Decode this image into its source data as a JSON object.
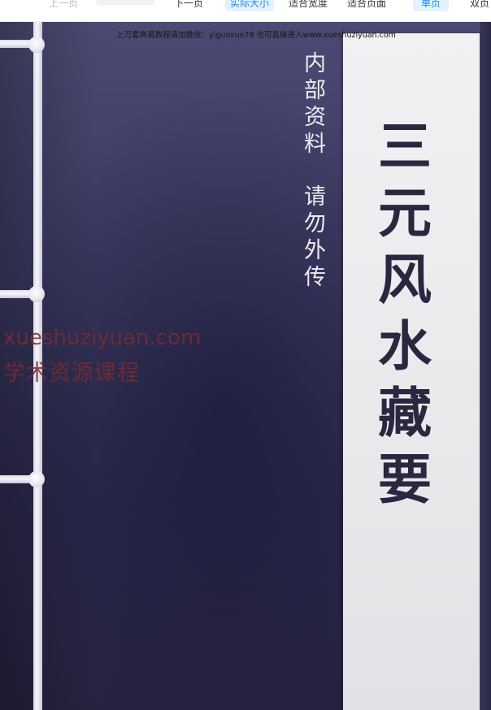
{
  "toolbar": {
    "prev_label": "上一页",
    "next_label": "下一页",
    "actual_size_label": "实际大小",
    "fit_width_label": "适合宽度",
    "fit_page_label": "适合页面",
    "single_page_label": "单页",
    "double_page_label": "双页",
    "accent_color": "#1a8cf0"
  },
  "page": {
    "notice": "上万套高易数程请加微信：yiguoxue78  也可直接进入www.xueshuziyuan.com",
    "side_text_1": "内部资料",
    "side_text_2": "请勿外传",
    "title": "三元风水藏要",
    "watermark_line1": "xueshuziyuan.com",
    "watermark_line2": "学术资源课程",
    "cover_color": "#3c3a62",
    "label_color": "#ececef"
  }
}
